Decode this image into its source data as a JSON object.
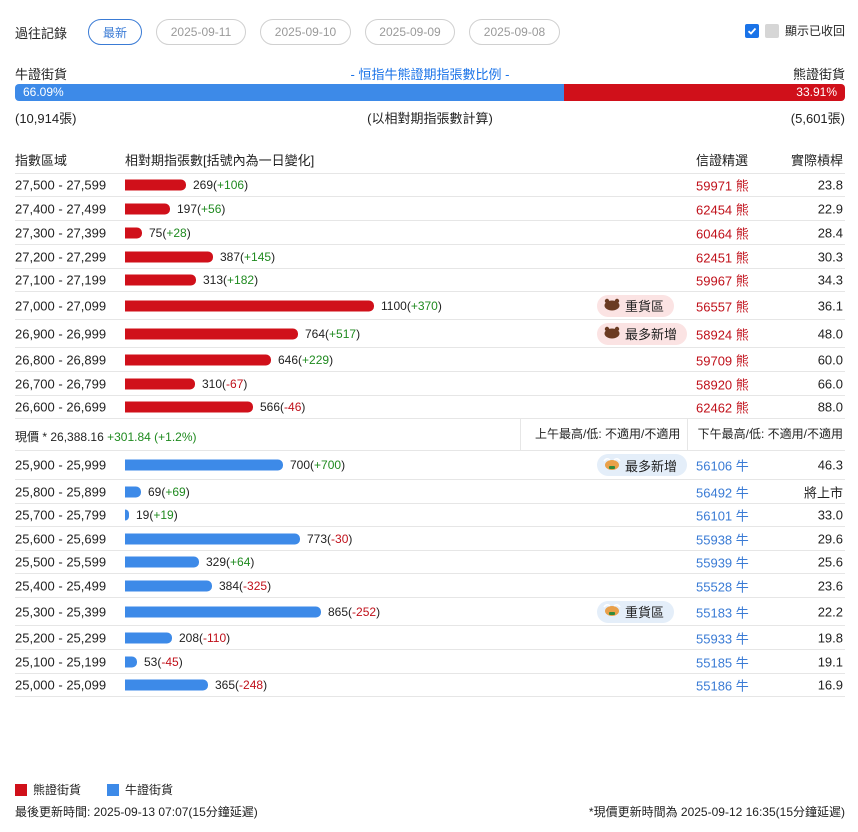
{
  "header": {
    "history_label": "過往記錄",
    "tabs": [
      "最新",
      "2025-09-11",
      "2025-09-10",
      "2025-09-09",
      "2025-09-08"
    ],
    "show_recalled_label": "顯示已收回"
  },
  "ratio": {
    "bull_label": "牛證街貨",
    "title": "- 恒指牛熊證期指張數比例 -",
    "bear_label": "熊證街貨",
    "bull_pct": "66.09%",
    "bear_pct": "33.91%",
    "bull_fraction": 0.6609,
    "bull_count": "(10,914張)",
    "basis_note": "(以相對期指張數計算)",
    "bear_count": "(5,601張)"
  },
  "table": {
    "headers": {
      "range": "指數區域",
      "contracts": "相對期指張數[括號內為一日變化]",
      "top_warrant": "信證精選",
      "leverage": "實際槓桿"
    },
    "bear_rows": [
      {
        "range": "27,500 - 27,599",
        "value": 269,
        "value_text": "269",
        "change": "+106",
        "code": "59971 熊",
        "leverage": "23.8",
        "tag": ""
      },
      {
        "range": "27,400 - 27,499",
        "value": 197,
        "value_text": "197",
        "change": "+56",
        "code": "62454 熊",
        "leverage": "22.9",
        "tag": ""
      },
      {
        "range": "27,300 - 27,399",
        "value": 75,
        "value_text": "75",
        "change": "+28",
        "code": "60464 熊",
        "leverage": "28.4",
        "tag": ""
      },
      {
        "range": "27,200 - 27,299",
        "value": 387,
        "value_text": "387",
        "change": "+145",
        "code": "62451 熊",
        "leverage": "30.3",
        "tag": ""
      },
      {
        "range": "27,100 - 27,199",
        "value": 313,
        "value_text": "313",
        "change": "+182",
        "code": "59967 熊",
        "leverage": "34.3",
        "tag": ""
      },
      {
        "range": "27,000 - 27,099",
        "value": 1100,
        "value_text": "1100",
        "change": "+370",
        "code": "56557 熊",
        "leverage": "36.1",
        "tag": "重貨區"
      },
      {
        "range": "26,900 - 26,999",
        "value": 764,
        "value_text": "764",
        "change": "+517",
        "code": "58924 熊",
        "leverage": "48.0",
        "tag": "最多新增"
      },
      {
        "range": "26,800 - 26,899",
        "value": 646,
        "value_text": "646",
        "change": "+229",
        "code": "59709 熊",
        "leverage": "60.0",
        "tag": ""
      },
      {
        "range": "26,700 - 26,799",
        "value": 310,
        "value_text": "310",
        "change": "-67",
        "code": "58920 熊",
        "leverage": "66.0",
        "tag": ""
      },
      {
        "range": "26,600 - 26,699",
        "value": 566,
        "value_text": "566",
        "change": "-46",
        "code": "62462 熊",
        "leverage": "88.0",
        "tag": ""
      }
    ],
    "price": {
      "label": "現價 *",
      "value": "26,388.16",
      "change": "+301.84 (+1.2%)",
      "am_text": "上午最高/低: 不適用/不適用",
      "pm_text": "下午最高/低: 不適用/不適用"
    },
    "bull_rows": [
      {
        "range": "25,900 - 25,999",
        "value": 700,
        "value_text": "700",
        "change": "+700",
        "code": "56106 牛",
        "leverage": "46.3",
        "tag": "最多新增"
      },
      {
        "range": "25,800 - 25,899",
        "value": 69,
        "value_text": "69",
        "change": "+69",
        "code": "56492 牛",
        "leverage": "將上市",
        "tag": ""
      },
      {
        "range": "25,700 - 25,799",
        "value": 19,
        "value_text": "19",
        "change": "+19",
        "code": "56101 牛",
        "leverage": "33.0",
        "tag": ""
      },
      {
        "range": "25,600 - 25,699",
        "value": 773,
        "value_text": "773",
        "change": "-30",
        "code": "55938 牛",
        "leverage": "29.6",
        "tag": ""
      },
      {
        "range": "25,500 - 25,599",
        "value": 329,
        "value_text": "329",
        "change": "+64",
        "code": "55939 牛",
        "leverage": "25.6",
        "tag": ""
      },
      {
        "range": "25,400 - 25,499",
        "value": 384,
        "value_text": "384",
        "change": "-325",
        "code": "55528 牛",
        "leverage": "23.6",
        "tag": ""
      },
      {
        "range": "25,300 - 25,399",
        "value": 865,
        "value_text": "865",
        "change": "-252",
        "code": "55183 牛",
        "leverage": "22.2",
        "tag": "重貨區"
      },
      {
        "range": "25,200 - 25,299",
        "value": 208,
        "value_text": "208",
        "change": "-110",
        "code": "55933 牛",
        "leverage": "19.8",
        "tag": ""
      },
      {
        "range": "25,100 - 25,199",
        "value": 53,
        "value_text": "53",
        "change": "-45",
        "code": "55185 牛",
        "leverage": "19.1",
        "tag": ""
      },
      {
        "range": "25,000 - 25,099",
        "value": 365,
        "value_text": "365",
        "change": "-248",
        "code": "55186 牛",
        "leverage": "16.9",
        "tag": ""
      }
    ]
  },
  "legend": {
    "bear_label": "熊證街貨",
    "bull_label": "牛證街貨",
    "bear_color": "#d0101a",
    "bull_color": "#3d8ae8"
  },
  "footer": {
    "last_update": "最後更新時間: 2025-09-13 07:07(15分鐘延遲)",
    "price_update": "*現價更新時間為 2025-09-12 16:35(15分鐘延遲)"
  }
}
